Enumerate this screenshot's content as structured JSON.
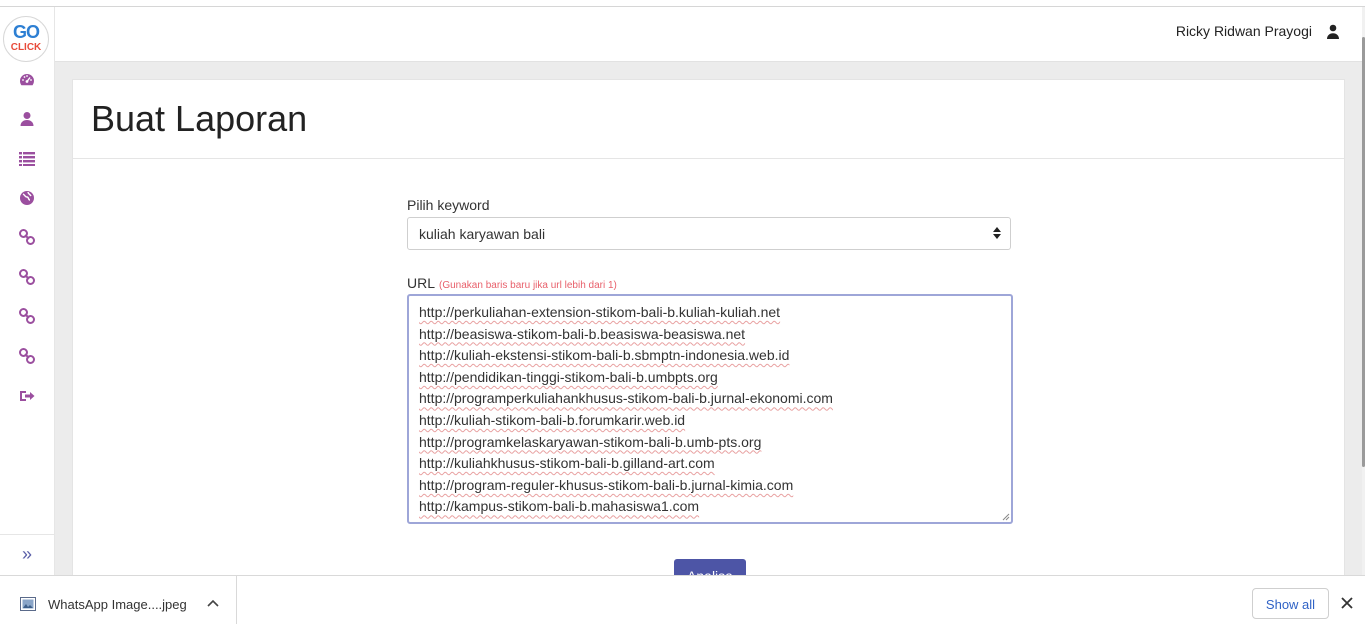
{
  "brand": {
    "logo_top": "GO",
    "logo_bottom": "CLICK"
  },
  "sidebar": {
    "items": [
      {
        "icon": "dashboard-icon"
      },
      {
        "icon": "user-icon"
      },
      {
        "icon": "list-icon"
      },
      {
        "icon": "globe-icon"
      },
      {
        "icon": "link-icon"
      },
      {
        "icon": "link-icon"
      },
      {
        "icon": "link-icon"
      },
      {
        "icon": "link-icon"
      },
      {
        "icon": "logout-icon"
      }
    ],
    "expand_glyph": "»",
    "icon_color": "#9b4f9f"
  },
  "header": {
    "username": "Ricky Ridwan Prayogi"
  },
  "page": {
    "title": "Buat Laporan",
    "keyword_label": "Pilih keyword",
    "keyword_value": "kuliah karyawan bali",
    "url_label": "URL",
    "url_hint": "(Gunakan baris baru jika url lebih dari 1)",
    "urls": [
      "http://perkuliahan-extension-stikom-bali-b.kuliah-kuliah.net",
      "http://beasiswa-stikom-bali-b.beasiswa-beasiswa.net",
      "http://kuliah-ekstensi-stikom-bali-b.sbmptn-indonesia.web.id",
      "http://pendidikan-tinggi-stikom-bali-b.umbpts.org",
      "http://programperkuliahankhusus-stikom-bali-b.jurnal-ekonomi.com",
      "http://kuliah-stikom-bali-b.forumkarir.web.id",
      "http://programkelaskaryawan-stikom-bali-b.umb-pts.org",
      "http://kuliahkhusus-stikom-bali-b.gilland-art.com",
      "http://program-reguler-khusus-stikom-bali-b.jurnal-kimia.com",
      "http://kampus-stikom-bali-b.mahasiswa1.com"
    ],
    "submit_label": "Analisa",
    "accent": "#4d55a6"
  },
  "downloads": {
    "file_name": "WhatsApp Image....jpeg",
    "show_all": "Show all"
  }
}
